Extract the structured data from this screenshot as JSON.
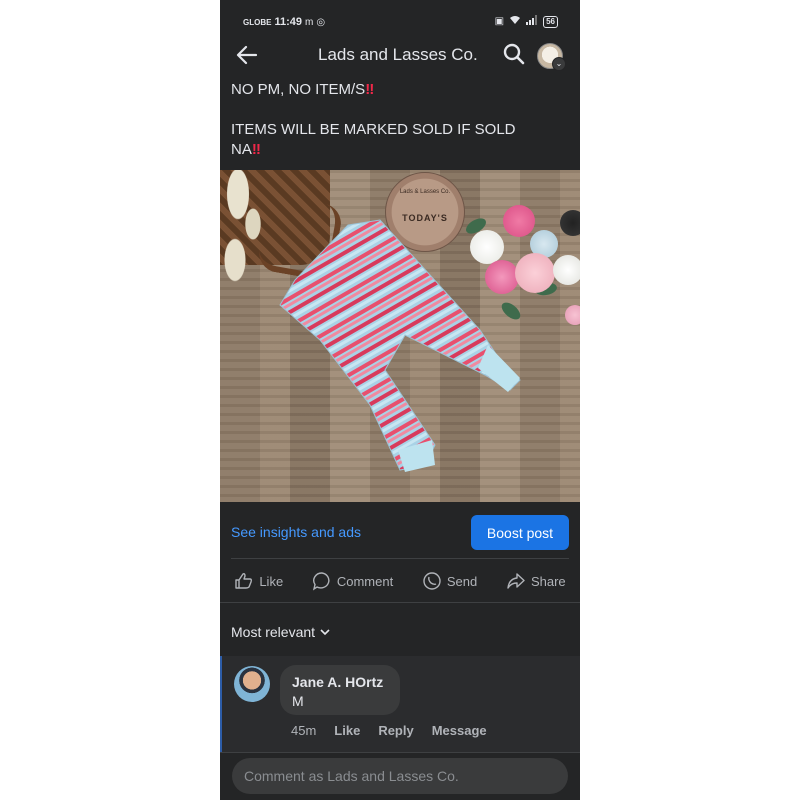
{
  "status_bar": {
    "carrier": "GLOBE",
    "time": "11:49",
    "battery": "56"
  },
  "header": {
    "title": "Lads and Lasses Co."
  },
  "post": {
    "caption_line1": "NO PM, NO ITEM/S",
    "caption_line2": "ITEMS WILL BE MARKED SOLD IF SOLD",
    "caption_line3": "NA",
    "emphasis": "‼",
    "photo_watermark_small": "Lads & Lasses Co.",
    "photo_watermark_big": "TODAY'S"
  },
  "insights_link": "See insights and ads",
  "boost_button": "Boost post",
  "actions": {
    "like": "Like",
    "comment": "Comment",
    "send": "Send",
    "share": "Share"
  },
  "sort": {
    "label": "Most relevant"
  },
  "comment": {
    "author": "Jane A. HOrtz",
    "text": "M",
    "time": "45m",
    "like": "Like",
    "reply": "Reply",
    "message": "Message"
  },
  "composer": {
    "placeholder": "Comment as Lads and Lasses Co."
  },
  "colors": {
    "background": "#242526",
    "accent": "#1b74e4",
    "link": "#4599ff",
    "alert": "#f02849"
  }
}
